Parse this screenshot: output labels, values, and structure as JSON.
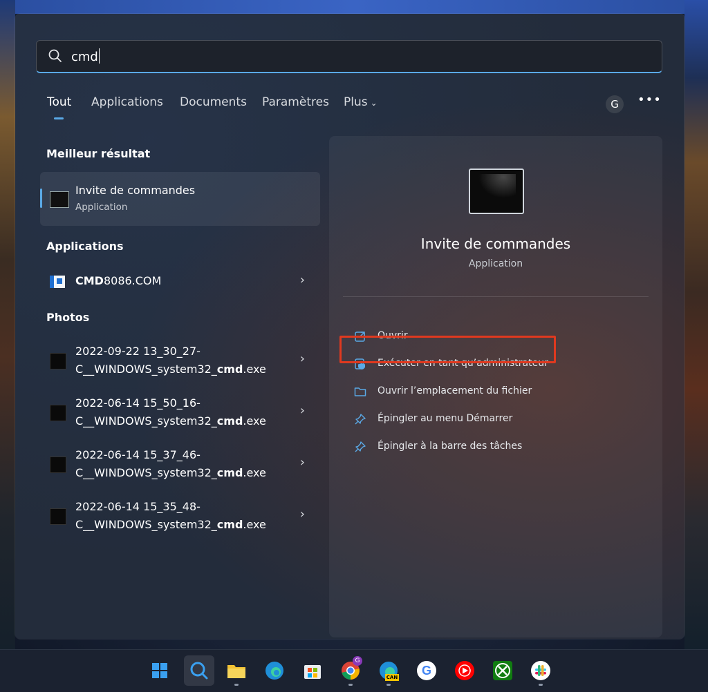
{
  "search": {
    "value": "cmd"
  },
  "tabs": [
    {
      "label": "Tout",
      "active": true
    },
    {
      "label": "Applications"
    },
    {
      "label": "Documents"
    },
    {
      "label": "Paramètres"
    },
    {
      "label": "Plus"
    }
  ],
  "account_initial": "G",
  "more_label": "•••",
  "best": {
    "section": "Meilleur résultat",
    "title": "Invite de commandes",
    "subtitle": "Application"
  },
  "apps": {
    "section": "Applications",
    "items": [
      {
        "name_bold": "CMD",
        "name_rest": "8086.COM"
      }
    ]
  },
  "photos": {
    "section": "Photos",
    "items": [
      {
        "line1": "2022-09-22 13_30_27-",
        "line2_a": "C__WINDOWS_system32_",
        "line2_b": "cmd",
        "line2_c": ".exe"
      },
      {
        "line1": "2022-06-14 15_50_16-",
        "line2_a": "C__WINDOWS_system32_",
        "line2_b": "cmd",
        "line2_c": ".exe"
      },
      {
        "line1": "2022-06-14 15_37_46-",
        "line2_a": "C__WINDOWS_system32_",
        "line2_b": "cmd",
        "line2_c": ".exe"
      },
      {
        "line1": "2022-06-14 15_35_48-",
        "line2_a": "C__WINDOWS_system32_",
        "line2_b": "cmd",
        "line2_c": ".exe"
      }
    ]
  },
  "detail": {
    "title": "Invite de commandes",
    "subtitle": "Application",
    "actions": [
      {
        "label": "Ouvrir",
        "icon": "open-external-icon"
      },
      {
        "label": "Exécuter en tant qu’administrateur",
        "icon": "shield-admin-icon"
      },
      {
        "label": "Ouvrir l’emplacement du fichier",
        "icon": "folder-icon"
      },
      {
        "label": "Épingler au menu Démarrer",
        "icon": "pin-icon"
      },
      {
        "label": "Épingler à la barre des tâches",
        "icon": "pin-icon"
      }
    ]
  },
  "taskbar": {
    "apps": [
      "windows-start",
      "search",
      "file-explorer",
      "edge",
      "microsoft-store",
      "chrome",
      "edge-canary",
      "google",
      "youtube-music",
      "xbox",
      "slack"
    ],
    "badges": {
      "chrome": "G",
      "edge-canary": "CAN"
    }
  },
  "colors": {
    "accent": "#5aa9e6",
    "highlight": "#e0391f",
    "panel": "#232c3b"
  }
}
